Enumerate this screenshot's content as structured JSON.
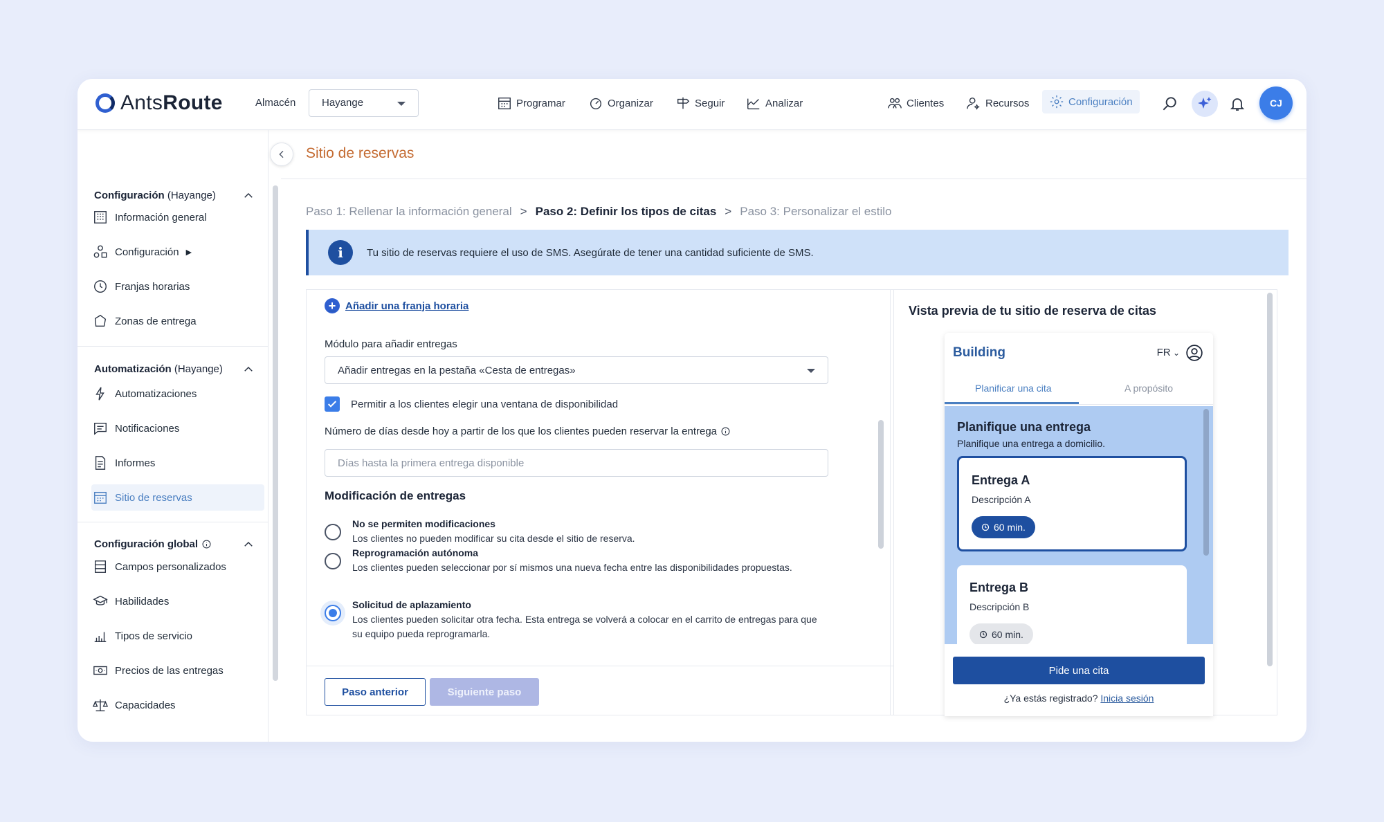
{
  "app": {
    "logo_text_light": "Ants",
    "logo_text_bold": "Route"
  },
  "topbar": {
    "warehouse_label": "Almacén",
    "warehouse_value": "Hayange",
    "nav": {
      "schedule": "Programar",
      "organize": "Organizar",
      "track": "Seguir",
      "analyze": "Analizar",
      "clients": "Clientes",
      "resources": "Recursos",
      "settings": "Configuración"
    },
    "avatar_initials": "CJ",
    "icons": {
      "search": "search-icon",
      "ai": "sparkle-icon",
      "notifications": "bell-icon"
    }
  },
  "sidebar": {
    "section1": {
      "title": "Configuración",
      "scope": "(Hayange)"
    },
    "section1_items": [
      "Información general",
      "Configuración",
      "Franjas horarias",
      "Zonas de entrega"
    ],
    "section2": {
      "title": "Automatización",
      "scope": "(Hayange)"
    },
    "section2_items": [
      "Automatizaciones",
      "Notificaciones",
      "Informes",
      "Sitio de reservas"
    ],
    "section3": {
      "title": "Configuración global"
    },
    "section3_items": [
      "Campos personalizados",
      "Habilidades",
      "Tipos de servicio",
      "Precios de las entregas",
      "Capacidades"
    ]
  },
  "page": {
    "title": "Sitio de reservas",
    "steps": {
      "step1": "Paso 1: Rellenar la información general",
      "sep": ">",
      "step2": "Paso 2: Definir los tipos de citas",
      "step3": "Paso 3: Personalizar el estilo"
    },
    "banner": "Tu sitio de reservas requiere el uso de SMS. Asegúrate de tener una cantidad suficiente de SMS."
  },
  "form": {
    "add_slot": "Añadir una franja horaria",
    "module_label": "Módulo para añadir entregas",
    "module_value": "Añadir entregas en la pestaña «Cesta de entregas»",
    "allow_window_label": "Permitir a los clientes elegir una ventana de disponibilidad",
    "allow_window_checked": true,
    "days_label": "Número de días desde hoy a partir de los que los clientes pueden reservar la entrega",
    "days_placeholder": "Días hasta la primera entrega disponible",
    "modifications_title": "Modificación de entregas",
    "options": [
      {
        "title": "No se permiten modificaciones",
        "desc": "Los clientes no pueden modificar su cita desde el sitio de reserva.",
        "selected": false
      },
      {
        "title": "Reprogramación autónoma",
        "desc": "Los clientes pueden seleccionar por sí mismos una nueva fecha entre las disponibilidades propuestas.",
        "selected": false
      },
      {
        "title": "Solicitud de aplazamiento",
        "desc": "Los clientes pueden solicitar otra fecha. Esta entrega se volverá a colocar en el carrito de entregas para que su equipo pueda reprogramarla.",
        "selected": true
      }
    ],
    "prev_button": "Paso anterior",
    "next_button": "Siguiente paso"
  },
  "preview": {
    "title": "Vista previa de tu sitio de reserva de citas",
    "brand": "Building",
    "lang": "FR",
    "tabs": [
      "Planificar una cita",
      "A propósito"
    ],
    "heading": "Planifique una entrega",
    "subheading": "Planifique una entrega a domicilio.",
    "cards": [
      {
        "title": "Entrega A",
        "desc": "Descripción A",
        "duration": "60 min."
      },
      {
        "title": "Entrega B",
        "desc": "Descripción B",
        "duration": "60 min."
      }
    ],
    "cta": "Pide una cita",
    "login_prompt": "¿Ya estás registrado?",
    "login_link": "Inicia sesión"
  },
  "colors": {
    "accent": "#1e4fa0",
    "active_nav": "#4a7fc1",
    "title_orange": "#c46b32",
    "banner_bg": "#cfe1f9"
  }
}
